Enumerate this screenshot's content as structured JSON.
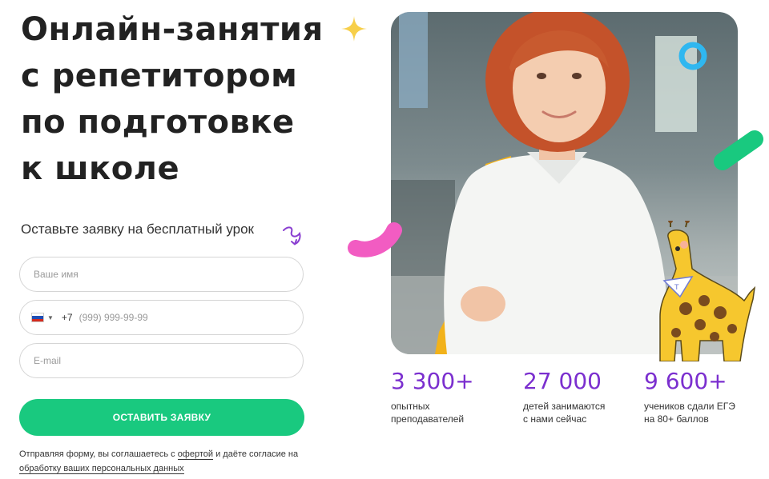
{
  "hero": {
    "title_lines": [
      "Онлайн-занятия",
      "с репетитором",
      "по подготовке",
      "к школе"
    ],
    "subtitle": "Оставьте заявку на бесплатный урок"
  },
  "form": {
    "name_placeholder": "Ваше имя",
    "phone_code": "+7",
    "phone_placeholder": "(999) 999-99-99",
    "email_placeholder": "E-mail",
    "submit_label": "ОСТАВИТЬ ЗАЯВКУ",
    "country_flag_icon": "russia-flag-icon"
  },
  "consent": {
    "text_1": "Отправляя форму, вы соглашаетесь с ",
    "offer_link": "офертой",
    "text_2": " и даёте согласие на ",
    "privacy_link": "обработку ваших персональных данных"
  },
  "stats": [
    {
      "value": "3 300+",
      "desc": "опытных\nпреподавателей"
    },
    {
      "value": "27 000",
      "desc": "детей занимаются\nс нами сейчас"
    },
    {
      "value": "9 600+",
      "desc": "учеников сдали ЕГЭ\nна 80+ баллов"
    }
  ],
  "colors": {
    "accent_green": "#19c97f",
    "accent_purple": "#7b2fcf",
    "accent_pink": "#f25cc2",
    "accent_blue": "#2fb7f0",
    "sparkle_yellow": "#f7cf4a"
  }
}
